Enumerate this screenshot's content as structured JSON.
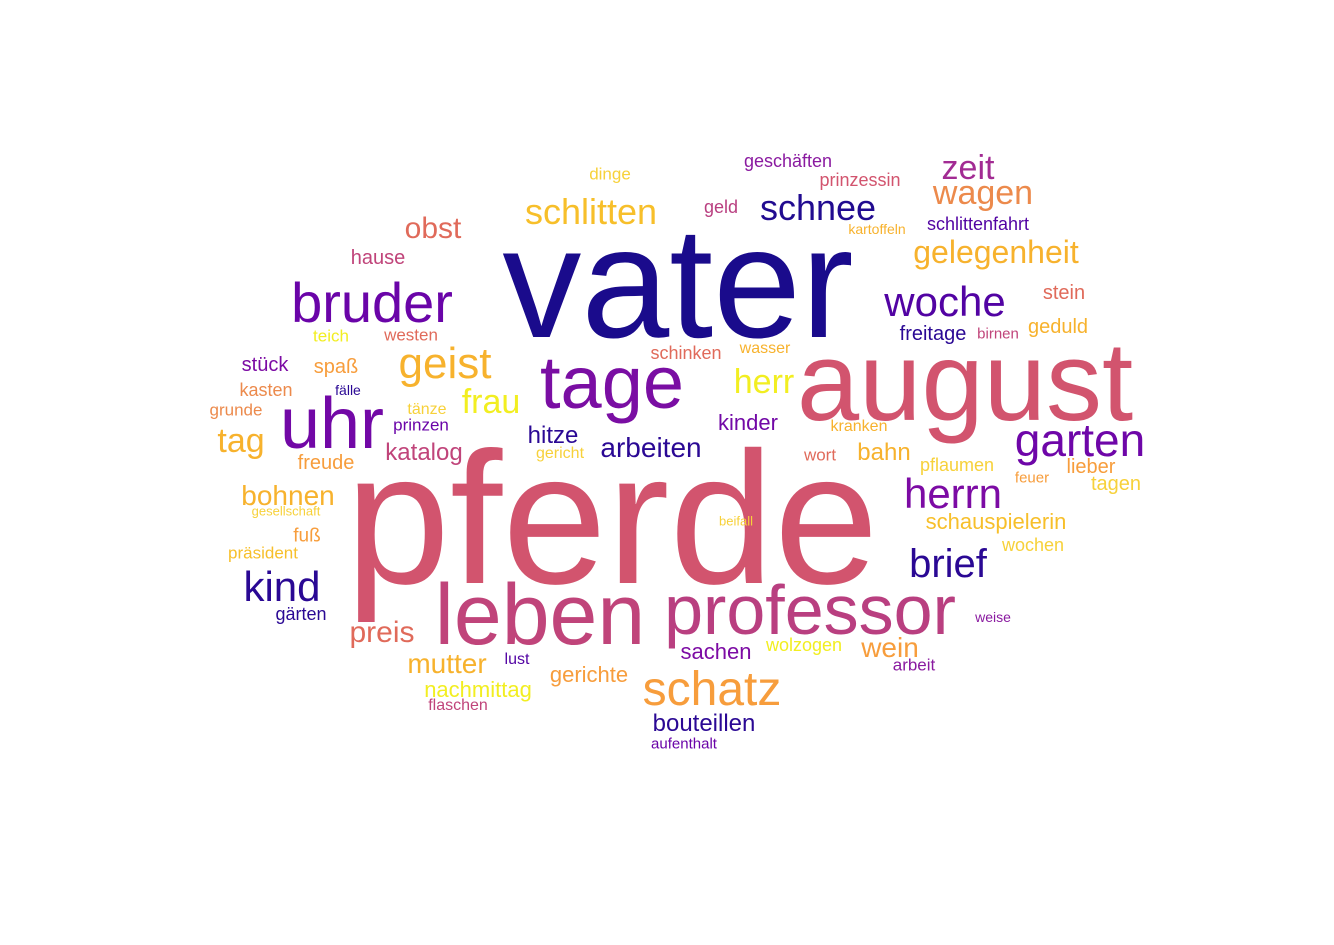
{
  "words": [
    {
      "text": "pferde",
      "color": "#d2546e"
    },
    {
      "text": "vater",
      "color": "#1a0b8c"
    },
    {
      "text": "august",
      "color": "#d2546e"
    },
    {
      "text": "leben",
      "color": "#c0447a"
    },
    {
      "text": "professor",
      "color": "#b93f80"
    },
    {
      "text": "tage",
      "color": "#7a0ea3"
    },
    {
      "text": "uhr",
      "color": "#7208a6"
    },
    {
      "text": "bruder",
      "color": "#6a04a8"
    },
    {
      "text": "schatz",
      "color": "#f79d3c"
    },
    {
      "text": "garten",
      "color": "#6e06a8"
    },
    {
      "text": "herrn",
      "color": "#7c0ba4"
    },
    {
      "text": "woche",
      "color": "#5203a3"
    },
    {
      "text": "geist",
      "color": "#f7b22d"
    },
    {
      "text": "schnee",
      "color": "#210b90"
    },
    {
      "text": "schlitten",
      "color": "#f7bf2a"
    },
    {
      "text": "kind",
      "color": "#2a0894"
    },
    {
      "text": "brief",
      "color": "#2a0894"
    },
    {
      "text": "zeit",
      "color": "#a22b93"
    },
    {
      "text": "wagen",
      "color": "#ec8a4c"
    },
    {
      "text": "gelegenheit",
      "color": "#f7b22d"
    },
    {
      "text": "herr",
      "color": "#f2ee21"
    },
    {
      "text": "frau",
      "color": "#f2ee21"
    },
    {
      "text": "tag",
      "color": "#f7b22d"
    },
    {
      "text": "mutter",
      "color": "#f7b22d"
    },
    {
      "text": "preis",
      "color": "#e06a5a"
    },
    {
      "text": "obst",
      "color": "#e06a5a"
    },
    {
      "text": "bohnen",
      "color": "#f7b22d"
    },
    {
      "text": "arbeiten",
      "color": "#2a0894"
    },
    {
      "text": "wein",
      "color": "#f79d3c"
    },
    {
      "text": "hitze",
      "color": "#2a0894"
    },
    {
      "text": "bouteillen",
      "color": "#2a0894"
    },
    {
      "text": "nachmittag",
      "color": "#f2ee21"
    },
    {
      "text": "katalog",
      "color": "#c0447a"
    },
    {
      "text": "sachen",
      "color": "#7c0ba4"
    },
    {
      "text": "bahn",
      "color": "#f7b22d"
    },
    {
      "text": "kinder",
      "color": "#7208a6"
    },
    {
      "text": "schauspielerin",
      "color": "#f7bf2a"
    },
    {
      "text": "gerichte",
      "color": "#f79d3c"
    },
    {
      "text": "geschäften",
      "color": "#8a1aa0"
    },
    {
      "text": "schlittenfahrt",
      "color": "#5203a3"
    },
    {
      "text": "prinzessin",
      "color": "#d2546e"
    },
    {
      "text": "tagen",
      "color": "#f7d13a"
    },
    {
      "text": "stein",
      "color": "#e06a5a"
    },
    {
      "text": "freitage",
      "color": "#2a0894"
    },
    {
      "text": "geduld",
      "color": "#f7b22d"
    },
    {
      "text": "hause",
      "color": "#c0447a"
    },
    {
      "text": "stück",
      "color": "#7c0ba4"
    },
    {
      "text": "freude",
      "color": "#f79d3c"
    },
    {
      "text": "lieber",
      "color": "#f79d3c"
    },
    {
      "text": "pflaumen",
      "color": "#f7d13a"
    },
    {
      "text": "wochen",
      "color": "#f7d13a"
    },
    {
      "text": "schinken",
      "color": "#e06a5a"
    },
    {
      "text": "spaß",
      "color": "#f79d3c"
    },
    {
      "text": "kasten",
      "color": "#ec8a4c"
    },
    {
      "text": "geld",
      "color": "#b93f80"
    },
    {
      "text": "dinge",
      "color": "#f7d13a"
    },
    {
      "text": "wolzogen",
      "color": "#f2ee21"
    },
    {
      "text": "arbeit",
      "color": "#8a1aa0"
    },
    {
      "text": "westen",
      "color": "#e06a5a"
    },
    {
      "text": "teich",
      "color": "#f2ee21"
    },
    {
      "text": "fuß",
      "color": "#f79d3c"
    },
    {
      "text": "präsident",
      "color": "#f7bf2a"
    },
    {
      "text": "gärten",
      "color": "#2a0894"
    },
    {
      "text": "wort",
      "color": "#e06a5a"
    },
    {
      "text": "prinzen",
      "color": "#6a04a8"
    },
    {
      "text": "kranken",
      "color": "#f7b22d"
    },
    {
      "text": "grunde",
      "color": "#ec8a4c"
    },
    {
      "text": "tänze",
      "color": "#f7d13a"
    },
    {
      "text": "wasser",
      "color": "#f7b22d"
    },
    {
      "text": "gericht",
      "color": "#f7d13a"
    },
    {
      "text": "lust",
      "color": "#5203a3"
    },
    {
      "text": "flaschen",
      "color": "#c0447a"
    },
    {
      "text": "aufenthalt",
      "color": "#6a04a8"
    },
    {
      "text": "kartoffeln",
      "color": "#f7b22d"
    },
    {
      "text": "birnen",
      "color": "#c0447a"
    },
    {
      "text": "feuer",
      "color": "#f79d3c"
    },
    {
      "text": "fälle",
      "color": "#2a0894"
    },
    {
      "text": "gesellschaft",
      "color": "#f7d13a"
    },
    {
      "text": "beifall",
      "color": "#f7d13a"
    },
    {
      "text": "weise",
      "color": "#8a1aa0"
    }
  ]
}
